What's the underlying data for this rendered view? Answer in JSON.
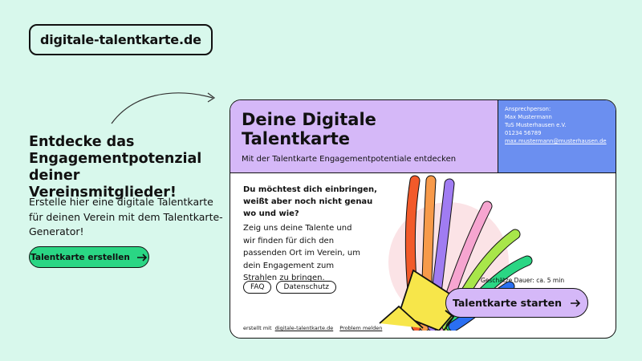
{
  "logo": {
    "text": "digitale-talentkarte.de"
  },
  "landing": {
    "headline": "Entdecke das Engagementpotenzial deiner Vereinsmitglieder!",
    "intro": "Erstelle hier eine digitale Talentkarte für deinen Verein mit dem Talentkarte-Generator!",
    "cta_label": "Talentkarte erstellen"
  },
  "card": {
    "title": "Deine Digitale Talentkarte",
    "subtitle": "Mit der Talentkarte Engagementpotentiale entdecken",
    "contact": {
      "label": "Ansprechperson:",
      "name": "Max Mustermann",
      "club": "TuS Musterhausen e.V.",
      "phone": "01234 56789",
      "email": "max.mustermann@musterhausen.de"
    },
    "question": "Du möchtest dich einbringen, weißt aber noch nicht genau wo und wie?",
    "body": "Zeig uns deine Talente und wir finden für dich den passenden Ort im Verein, um dein Engagement zum Strahlen zu bringen.",
    "pills": [
      "FAQ",
      "Datenschutz"
    ],
    "duration": "Geschätze Dauer: ca. 5 min",
    "cta_label": "Talentkarte starten",
    "footer": {
      "prefix": "erstellt mit",
      "link": "digitale-talentkarte.de",
      "report": "Problem melden"
    }
  },
  "colors": {
    "background": "#d8f8ec",
    "green": "#2ad684",
    "lilac": "#d5b8f8",
    "blue": "#6b8ff0",
    "yellow": "#f7e64a"
  },
  "icons": [
    "arrow-right-icon",
    "curved-arrow-icon",
    "megaphone-illustration"
  ]
}
